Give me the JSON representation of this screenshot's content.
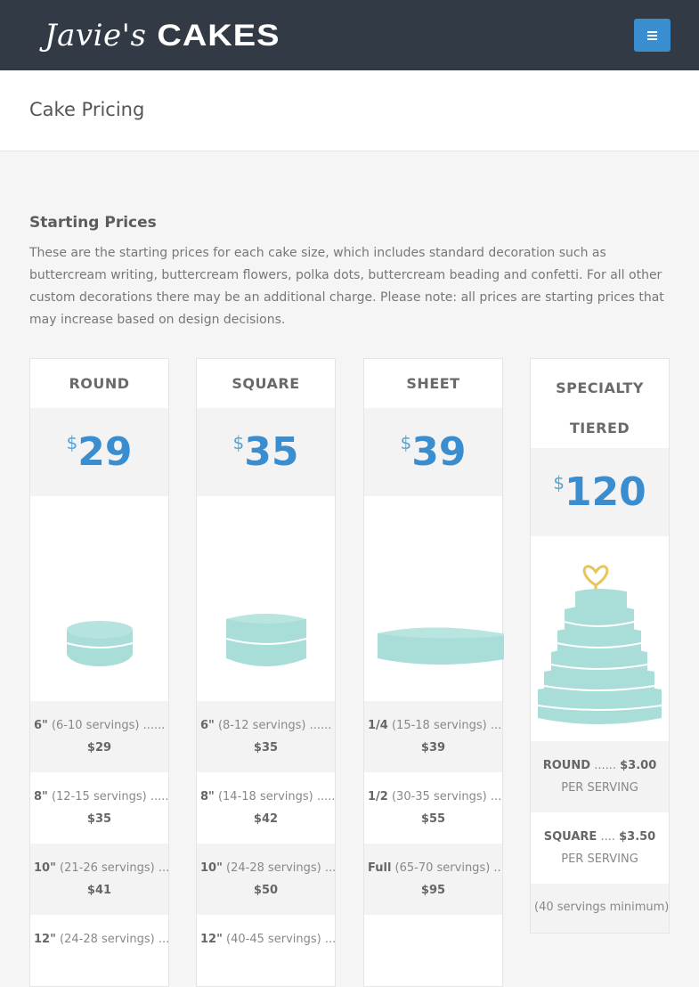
{
  "header": {
    "logo_script": "Javie's",
    "logo_caps": "CAKES"
  },
  "page": {
    "title": "Cake Pricing"
  },
  "intro": {
    "heading": "Starting Prices",
    "text": "These are the starting prices for each cake size, which includes standard decoration such as buttercream writing, buttercream flowers, polka dots, buttercream beading and confetti. For all other custom decorations there may be an additional charge. Please note: all prices are starting prices that may increase based on design decisions."
  },
  "columns": [
    {
      "name": "ROUND",
      "currency": "$",
      "price": "29",
      "rows": [
        {
          "size": "6\"",
          "servings": "(6-10 servings) ......",
          "price": "$29"
        },
        {
          "size": "8\"",
          "servings": "(12-15 servings) ......",
          "price": "$35"
        },
        {
          "size": "10\"",
          "servings": "(21-26 servings) ...",
          "price": "$41"
        },
        {
          "size": "12\"",
          "servings": "(24-28 servings) ...",
          "price": ""
        }
      ]
    },
    {
      "name": "SQUARE",
      "currency": "$",
      "price": "35",
      "rows": [
        {
          "size": "6\"",
          "servings": "(8-12 servings) ......",
          "price": "$35"
        },
        {
          "size": "8\"",
          "servings": "(14-18 servings) ......",
          "price": "$42"
        },
        {
          "size": "10\"",
          "servings": "(24-28 servings) ...",
          "price": "$50"
        },
        {
          "size": "12\"",
          "servings": "(40-45 servings) ...",
          "price": ""
        }
      ]
    },
    {
      "name": "SHEET",
      "currency": "$",
      "price": "39",
      "rows": [
        {
          "size": "1/4",
          "servings": "(15-18 servings) ......",
          "price": "$39"
        },
        {
          "size": "1/2",
          "servings": "(30-35 servings) ......",
          "price": "$55"
        },
        {
          "size": "Full",
          "servings": "(65-70 servings) ...",
          "price": "$95"
        }
      ]
    },
    {
      "name_line1": "SPECIALTY",
      "name_line2": "TIERED",
      "currency": "$",
      "price": "120",
      "rows": [
        {
          "label": "ROUND",
          "dots": "......",
          "price": "$3.00",
          "unit": "PER SERVING"
        },
        {
          "label": "SQUARE",
          "dots": "....",
          "price": "$3.50",
          "unit": "PER SERVING"
        },
        {
          "note": "(40 servings minimum)"
        }
      ]
    }
  ],
  "colors": {
    "navbar": "#323a45",
    "accent": "#3a8ecf",
    "cake_fill": "#a8ddd8"
  }
}
